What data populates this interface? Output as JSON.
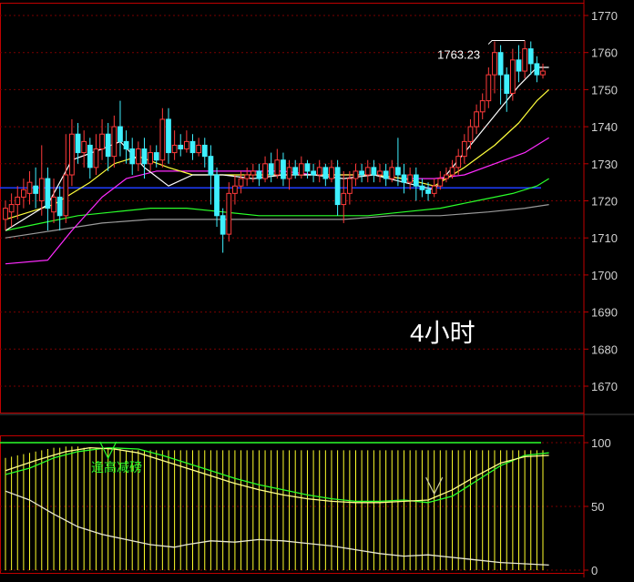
{
  "colors": {
    "background": "#000000",
    "frame": "#c00000",
    "grid": "#7a0000",
    "axis_text": "#d0d0d0",
    "up_candle": "#ff3b3b",
    "down_candle": "#3ff0ff",
    "ma1": "#ffffff",
    "ma2": "#ffff3c",
    "ma3": "#ff2bff",
    "ma4": "#2aff2a",
    "ma5": "#9a9a9a",
    "blue_line": "#1e3cff",
    "osc_bars": "#ffff2a",
    "osc_top_line": "#2aff2a",
    "annotation": "#ffffff"
  },
  "chart_data": [
    {
      "type": "candlestick",
      "period_label": "4小时",
      "y_ticks": [
        "1770",
        "1760",
        "1750",
        "1740",
        "1730",
        "1720",
        "1710",
        "1700",
        "1690",
        "1680",
        "1670"
      ],
      "ylim": [
        1662,
        1774
      ],
      "high_annotation": "1763.23",
      "high_value": 1763.23,
      "horizontal_line_value": 1723.5,
      "candles": [
        [
          1715,
          1718,
          1712,
          1720
        ],
        [
          1717,
          1719,
          1713,
          1722
        ],
        [
          1719,
          1721,
          1715,
          1724
        ],
        [
          1721,
          1723,
          1718,
          1726
        ],
        [
          1722,
          1725,
          1719,
          1728
        ],
        [
          1724,
          1722,
          1718,
          1729
        ],
        [
          1720,
          1726,
          1716,
          1735
        ],
        [
          1726,
          1718,
          1712,
          1729
        ],
        [
          1717,
          1721,
          1714,
          1726
        ],
        [
          1721,
          1716,
          1712,
          1724
        ],
        [
          1716,
          1727,
          1714,
          1738
        ],
        [
          1727,
          1738,
          1724,
          1742
        ],
        [
          1738,
          1733,
          1730,
          1741
        ],
        [
          1733,
          1736,
          1729,
          1739
        ],
        [
          1735,
          1729,
          1726,
          1737
        ],
        [
          1729,
          1734,
          1727,
          1738
        ],
        [
          1734,
          1738,
          1731,
          1742
        ],
        [
          1738,
          1732,
          1728,
          1741
        ],
        [
          1732,
          1740,
          1729,
          1743
        ],
        [
          1740,
          1736,
          1732,
          1747
        ],
        [
          1736,
          1734,
          1730,
          1739
        ],
        [
          1734,
          1730,
          1727,
          1737
        ],
        [
          1730,
          1734,
          1728,
          1736
        ],
        [
          1734,
          1730,
          1726,
          1737
        ],
        [
          1730,
          1733,
          1728,
          1735
        ],
        [
          1733,
          1731,
          1729,
          1735
        ],
        [
          1731,
          1742,
          1729,
          1745
        ],
        [
          1742,
          1733,
          1730,
          1745
        ],
        [
          1733,
          1735,
          1731,
          1739
        ],
        [
          1735,
          1734,
          1732,
          1738
        ],
        [
          1734,
          1736,
          1733,
          1739
        ],
        [
          1736,
          1733,
          1731,
          1738
        ],
        [
          1733,
          1735,
          1732,
          1737
        ],
        [
          1735,
          1732,
          1729,
          1737
        ],
        [
          1732,
          1727,
          1719,
          1735
        ],
        [
          1727,
          1716,
          1713,
          1729
        ],
        [
          1716,
          1711,
          1706,
          1718
        ],
        [
          1711,
          1722,
          1709,
          1725
        ],
        [
          1722,
          1724,
          1719,
          1727
        ],
        [
          1724,
          1726,
          1722,
          1728
        ],
        [
          1726,
          1727,
          1724,
          1729
        ],
        [
          1727,
          1728,
          1725,
          1730
        ],
        [
          1728,
          1726,
          1724,
          1730
        ],
        [
          1726,
          1730,
          1725,
          1732
        ],
        [
          1730,
          1727,
          1725,
          1733
        ],
        [
          1727,
          1731,
          1726,
          1734
        ],
        [
          1731,
          1726,
          1724,
          1733
        ],
        [
          1726,
          1729,
          1723,
          1731
        ],
        [
          1729,
          1727,
          1726,
          1731
        ],
        [
          1727,
          1730,
          1726,
          1732
        ],
        [
          1730,
          1728,
          1726,
          1731
        ],
        [
          1728,
          1727,
          1725,
          1730
        ],
        [
          1727,
          1729,
          1725,
          1731
        ],
        [
          1729,
          1726,
          1724,
          1730
        ],
        [
          1726,
          1729,
          1725,
          1731
        ],
        [
          1729,
          1719,
          1716,
          1731
        ],
        [
          1719,
          1722,
          1714,
          1728
        ],
        [
          1722,
          1726,
          1719,
          1728
        ],
        [
          1726,
          1728,
          1724,
          1730
        ],
        [
          1728,
          1727,
          1725,
          1730
        ],
        [
          1727,
          1729,
          1725,
          1731
        ],
        [
          1729,
          1727,
          1725,
          1731
        ],
        [
          1727,
          1728,
          1725,
          1730
        ],
        [
          1728,
          1726,
          1724,
          1730
        ],
        [
          1726,
          1729,
          1725,
          1731
        ],
        [
          1729,
          1727,
          1724,
          1737
        ],
        [
          1727,
          1725,
          1722,
          1730
        ],
        [
          1725,
          1727,
          1723,
          1729
        ],
        [
          1727,
          1724,
          1720,
          1729
        ],
        [
          1724,
          1723,
          1721,
          1726
        ],
        [
          1723,
          1722,
          1720,
          1725
        ],
        [
          1722,
          1724,
          1721,
          1726
        ],
        [
          1724,
          1726,
          1723,
          1728
        ],
        [
          1726,
          1727,
          1725,
          1729
        ],
        [
          1727,
          1729,
          1726,
          1731
        ],
        [
          1729,
          1732,
          1727,
          1734
        ],
        [
          1732,
          1736,
          1730,
          1738
        ],
        [
          1736,
          1740,
          1734,
          1742
        ],
        [
          1740,
          1744,
          1738,
          1746
        ],
        [
          1744,
          1747,
          1742,
          1749
        ],
        [
          1747,
          1754,
          1745,
          1756
        ],
        [
          1754,
          1760,
          1749,
          1763
        ],
        [
          1760,
          1754,
          1746,
          1762
        ],
        [
          1754,
          1749,
          1744,
          1756
        ],
        [
          1749,
          1758,
          1747,
          1761
        ],
        [
          1758,
          1755,
          1752,
          1762
        ],
        [
          1755,
          1761,
          1753,
          1763.23
        ],
        [
          1761,
          1757,
          1754,
          1763
        ],
        [
          1757,
          1754,
          1752,
          1759
        ],
        [
          1754,
          1755,
          1753,
          1757
        ]
      ],
      "moving_averages": {
        "ma1": [
          [
            0,
            1712
          ],
          [
            7,
            1719
          ],
          [
            11,
            1731
          ],
          [
            16,
            1734
          ],
          [
            19,
            1736
          ],
          [
            23,
            1729
          ],
          [
            27,
            1724
          ],
          [
            31,
            1727
          ],
          [
            36,
            1727
          ],
          [
            41,
            1726
          ],
          [
            46,
            1727
          ],
          [
            51,
            1727
          ],
          [
            56,
            1726
          ],
          [
            61,
            1727
          ],
          [
            66,
            1725
          ],
          [
            71,
            1723
          ],
          [
            76,
            1733
          ],
          [
            81,
            1743
          ],
          [
            85,
            1751
          ],
          [
            88,
            1756
          ],
          [
            90,
            1756
          ]
        ],
        "ma2": [
          [
            0,
            1715
          ],
          [
            8,
            1719
          ],
          [
            14,
            1725
          ],
          [
            18,
            1730
          ],
          [
            22,
            1732
          ],
          [
            27,
            1729
          ],
          [
            31,
            1727
          ],
          [
            36,
            1727
          ],
          [
            41,
            1727
          ],
          [
            46,
            1727
          ],
          [
            51,
            1727
          ],
          [
            56,
            1727
          ],
          [
            61,
            1727
          ],
          [
            66,
            1726
          ],
          [
            71,
            1724
          ],
          [
            76,
            1729
          ],
          [
            81,
            1735
          ],
          [
            85,
            1741
          ],
          [
            88,
            1747
          ],
          [
            90,
            1750
          ]
        ],
        "ma3": [
          [
            0,
            1703
          ],
          [
            7,
            1704
          ],
          [
            11,
            1712
          ],
          [
            16,
            1721
          ],
          [
            20,
            1726
          ],
          [
            25,
            1728
          ],
          [
            30,
            1728
          ],
          [
            36,
            1728
          ],
          [
            41,
            1728
          ],
          [
            46,
            1728
          ],
          [
            51,
            1727
          ],
          [
            56,
            1727
          ],
          [
            61,
            1727
          ],
          [
            66,
            1726
          ],
          [
            71,
            1726
          ],
          [
            76,
            1727
          ],
          [
            81,
            1730
          ],
          [
            86,
            1733
          ],
          [
            90,
            1737
          ]
        ],
        "ma4": [
          [
            0,
            1712
          ],
          [
            6,
            1714
          ],
          [
            12,
            1716
          ],
          [
            18,
            1717
          ],
          [
            24,
            1718
          ],
          [
            30,
            1718
          ],
          [
            36,
            1717
          ],
          [
            42,
            1716
          ],
          [
            48,
            1716
          ],
          [
            54,
            1716
          ],
          [
            60,
            1716
          ],
          [
            66,
            1717
          ],
          [
            72,
            1718
          ],
          [
            78,
            1720
          ],
          [
            84,
            1722
          ],
          [
            88,
            1724
          ],
          [
            90,
            1726
          ]
        ],
        "ma5": [
          [
            0,
            1710
          ],
          [
            8,
            1712
          ],
          [
            16,
            1714
          ],
          [
            24,
            1715
          ],
          [
            32,
            1715
          ],
          [
            40,
            1715
          ],
          [
            48,
            1715
          ],
          [
            56,
            1715
          ],
          [
            64,
            1716
          ],
          [
            72,
            1716
          ],
          [
            80,
            1717
          ],
          [
            86,
            1718
          ],
          [
            90,
            1719
          ]
        ]
      }
    },
    {
      "type": "oscillator",
      "y_ticks": [
        "100",
        "50",
        "0"
      ],
      "ylim": [
        0,
        100
      ],
      "top_line_value": 100,
      "bar_heights": [
        88,
        89,
        90,
        91,
        92,
        93,
        94,
        95,
        96,
        96,
        97,
        97,
        97,
        96,
        96,
        96,
        95,
        95,
        95,
        95,
        94,
        94,
        94,
        94,
        94,
        94,
        94,
        94,
        94,
        94,
        94,
        94,
        94,
        94,
        94,
        94,
        94,
        94,
        94,
        94,
        94,
        94,
        94,
        94,
        94,
        94,
        94,
        94,
        94,
        94,
        94,
        94,
        94,
        94,
        94,
        94,
        94,
        94,
        94,
        94,
        94,
        94,
        94,
        94,
        94,
        94,
        94,
        94,
        94,
        94,
        94,
        94,
        94,
        94,
        94,
        94,
        94,
        94,
        94,
        94,
        94,
        94,
        94,
        94,
        94,
        94,
        94,
        94,
        94,
        94
      ],
      "line_a": [
        [
          0,
          75
        ],
        [
          4,
          80
        ],
        [
          8,
          88
        ],
        [
          12,
          93
        ],
        [
          17,
          96
        ],
        [
          22,
          95
        ],
        [
          26,
          90
        ],
        [
          30,
          84
        ],
        [
          34,
          78
        ],
        [
          38,
          72
        ],
        [
          42,
          67
        ],
        [
          46,
          63
        ],
        [
          50,
          59
        ],
        [
          54,
          56
        ],
        [
          58,
          54
        ],
        [
          62,
          54
        ],
        [
          66,
          55
        ],
        [
          70,
          53
        ],
        [
          74,
          58
        ],
        [
          78,
          70
        ],
        [
          82,
          82
        ],
        [
          86,
          90
        ],
        [
          90,
          92
        ]
      ],
      "line_b": [
        [
          0,
          78
        ],
        [
          5,
          86
        ],
        [
          10,
          93
        ],
        [
          14,
          96
        ],
        [
          18,
          95
        ],
        [
          22,
          92
        ],
        [
          26,
          86
        ],
        [
          30,
          80
        ],
        [
          34,
          74
        ],
        [
          38,
          68
        ],
        [
          42,
          63
        ],
        [
          46,
          59
        ],
        [
          50,
          56
        ],
        [
          54,
          54
        ],
        [
          58,
          53
        ],
        [
          62,
          53
        ],
        [
          66,
          54
        ],
        [
          70,
          55
        ],
        [
          74,
          63
        ],
        [
          78,
          74
        ],
        [
          82,
          84
        ],
        [
          86,
          89
        ],
        [
          90,
          90
        ]
      ],
      "line_c": [
        [
          0,
          62
        ],
        [
          4,
          55
        ],
        [
          8,
          44
        ],
        [
          12,
          34
        ],
        [
          16,
          28
        ],
        [
          20,
          24
        ],
        [
          24,
          20
        ],
        [
          28,
          18
        ],
        [
          30,
          20
        ],
        [
          34,
          23
        ],
        [
          38,
          22
        ],
        [
          42,
          24
        ],
        [
          46,
          23
        ],
        [
          50,
          21
        ],
        [
          54,
          19
        ],
        [
          58,
          16
        ],
        [
          62,
          13
        ],
        [
          66,
          11
        ],
        [
          70,
          12
        ],
        [
          74,
          10
        ],
        [
          78,
          8
        ],
        [
          82,
          6
        ],
        [
          86,
          5
        ],
        [
          90,
          4
        ]
      ],
      "caret_marks": [
        [
          17,
          100
        ],
        [
          71,
          72
        ]
      ],
      "annotation": "逢高减磅"
    }
  ]
}
